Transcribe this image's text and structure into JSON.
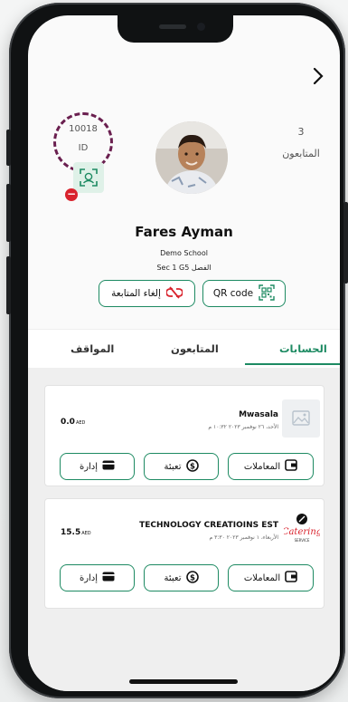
{
  "profile": {
    "id_number": "10018",
    "id_label": "ID",
    "followers_count": "3",
    "followers_label": "المتابعون",
    "name": "Fares Ayman",
    "school": "Demo School",
    "class": "Sec 1 G5  الفصل"
  },
  "actions": {
    "qr_label": "QR code",
    "unfollow_label": "إلغاء المتابعة"
  },
  "tabs": [
    "الحسابات",
    "المتابعون",
    "المواقف"
  ],
  "active_tab": "الحسابات",
  "accounts": [
    {
      "name": "Mwasala",
      "date": "الأحد، ٢٦ نوفمبر ٢٠٢٣ ١٠:٣٢ م",
      "amount": "0.0",
      "currency": "AED",
      "buttons": {
        "transactions": "المعاملات",
        "topup": "تعبئة",
        "manage": "إدارة"
      }
    },
    {
      "name": "TECHNOLOGY CREATIOINS EST",
      "date": "الأربعاء، ١ نوفمبر ٢٠٢٣ ٣:٣٠ م",
      "amount": "15.5",
      "currency": "AED",
      "logo_text": "Catering",
      "logo_subtext": "SERVICE",
      "buttons": {
        "transactions": "المعاملات",
        "topup": "تعبئة",
        "manage": "إدارة"
      }
    }
  ],
  "colors": {
    "accent": "#1d8a62",
    "dashed_circle": "#6a1f4f",
    "alert": "#d9232d"
  },
  "icons": [
    "chevron-right-icon",
    "scan-face-icon",
    "minus-badge-icon",
    "qr-code-icon",
    "unlink-icon",
    "image-placeholder-icon",
    "wallet-icon",
    "dollar-circle-icon",
    "card-icon"
  ]
}
